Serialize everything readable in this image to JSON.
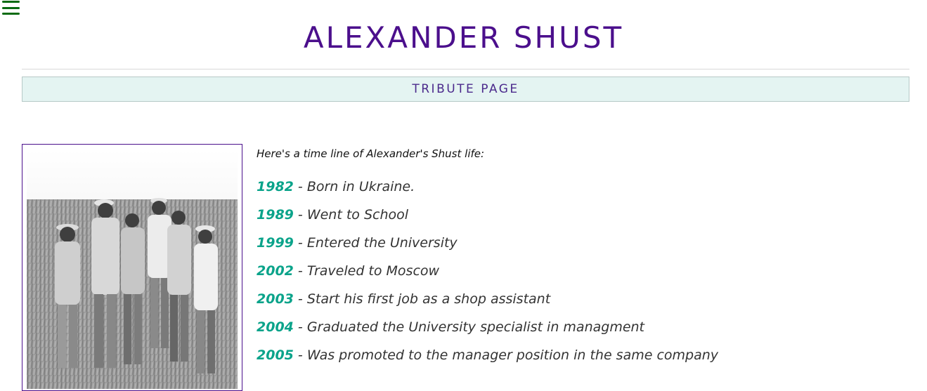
{
  "header": {
    "menu_icon": "hamburger-menu-icon",
    "title": "ALEXANDER SHUST",
    "subtitle": "TRIBUTE PAGE"
  },
  "colors": {
    "title": "#4b0f8c",
    "subtitle_band": "#e4f4f2",
    "year_accent": "#0aa38a",
    "menu_icon": "#0a6b13"
  },
  "timeline": {
    "intro": "Here's a time line of Alexander's Shust life:",
    "events": [
      {
        "year": "1982",
        "text": " - Born in Ukraine."
      },
      {
        "year": "1989",
        "text": " - Went to School"
      },
      {
        "year": "1999",
        "text": " - Entered the University"
      },
      {
        "year": "2002",
        "text": " - Traveled to Moscow"
      },
      {
        "year": "2003",
        "text": " - Start his first job as a shop assistant"
      },
      {
        "year": "2004",
        "text": " - Graduated the University specialist in managment"
      },
      {
        "year": "2005",
        "text": " - Was promoted to the manager position in the same company"
      }
    ]
  }
}
